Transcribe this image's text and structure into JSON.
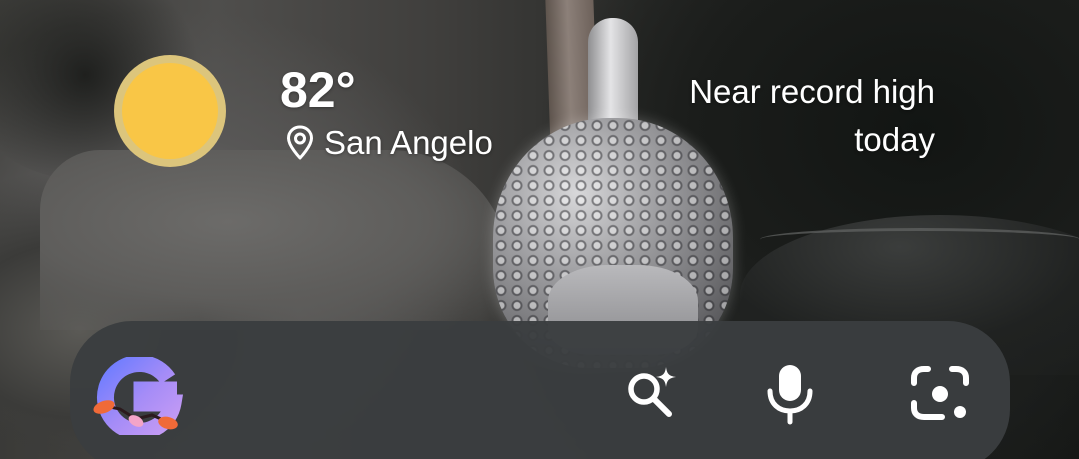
{
  "weather": {
    "temperature": "82°",
    "location": "San Angelo",
    "forecast_line1": "Near record high",
    "forecast_line2": "today",
    "condition_icon": "sun-icon",
    "sun_color": "#f9c646"
  },
  "search_bar": {
    "logo": "google-g-logo",
    "actions": [
      {
        "name": "ai-search",
        "icon": "sparkle-search-icon"
      },
      {
        "name": "voice-search",
        "icon": "microphone-icon"
      },
      {
        "name": "lens-search",
        "icon": "camera-lens-icon"
      }
    ],
    "background_color": "#3a3d3f"
  }
}
